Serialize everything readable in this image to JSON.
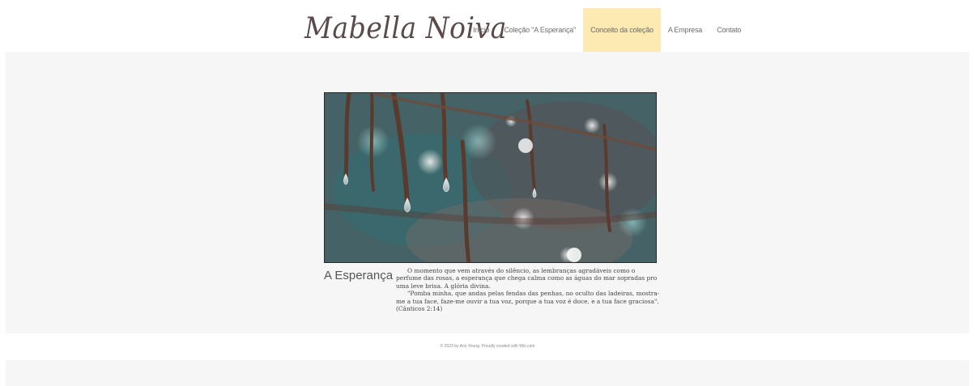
{
  "header": {
    "logo": "Mabella Noiva",
    "nav": [
      {
        "label": "Início",
        "active": false
      },
      {
        "label": "Coleção \"A Esperança\"",
        "active": true,
        "highlight": false
      },
      {
        "label": "Conceito da coleção",
        "active": true
      },
      {
        "label": "A Empresa",
        "active": false
      },
      {
        "label": "Contato",
        "active": false
      }
    ]
  },
  "main": {
    "image_alt": "water drops on branches",
    "section_title": "A Esperança",
    "paragraph_1": "O momento que vem através do silêncio, as lembranças agradáveis como o perfume das rosas, a esperança que chega calma como as águas do mar sopradas pro uma leve brisa. A glória divina.",
    "paragraph_2": "\"Pomba minha, que andas pelas fendas das penhas, no oculto das ladeiras, mostra-me a tua face, faze-me ouvir a tua voz, porque a tua voz é doce, e a tua face graciosa\". (Cânticos 2:14)"
  },
  "footer": {
    "text": "© 2023 by Ann Young. Proudly created with Wix.com"
  },
  "colors": {
    "active_nav": "#fdeab2",
    "content_bg": "#f6f6f6"
  }
}
